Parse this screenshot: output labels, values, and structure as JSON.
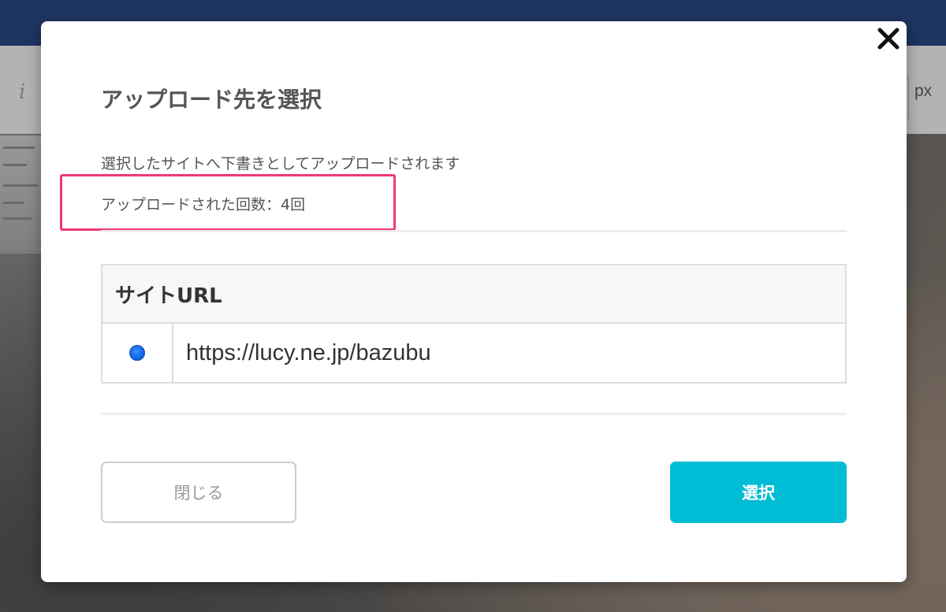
{
  "background": {
    "toolbar_glyph": "i",
    "unit_label": "px"
  },
  "modal": {
    "title": "アップロード先を選択",
    "description": "選択したサイトへ下書きとしてアップロードされます",
    "upload_count": "アップロードされた回数：4回",
    "table": {
      "header": "サイトURL",
      "rows": [
        {
          "selected": true,
          "url": "https://lucy.ne.jp/bazubu"
        }
      ]
    },
    "buttons": {
      "close": "閉じる",
      "select": "選択"
    }
  },
  "colors": {
    "highlight": "#ef3a74",
    "primary_button": "#00bcd4",
    "topbar": "#1e3462",
    "radio_selected": "#0a62e0"
  },
  "icons": {
    "close": "close-icon",
    "radio": "radio-selected-icon"
  }
}
